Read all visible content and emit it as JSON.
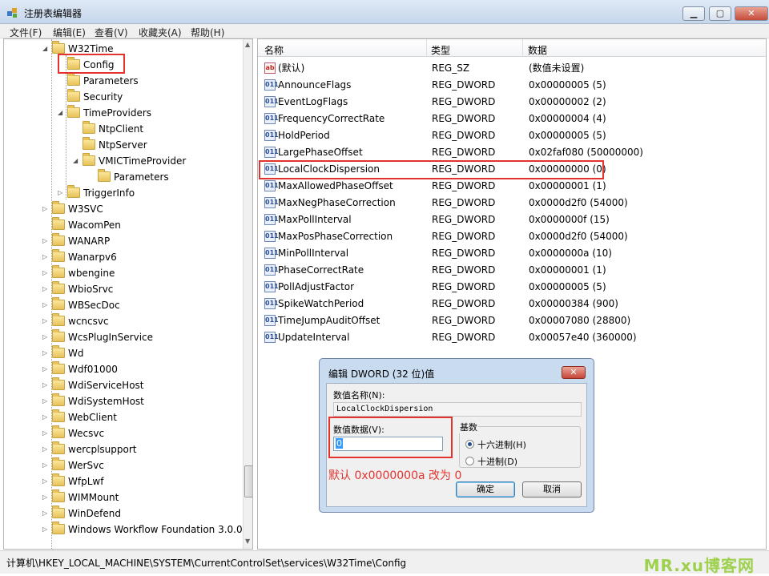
{
  "window": {
    "title": "注册表编辑器",
    "btn_min": "▁",
    "btn_max": "▢",
    "btn_close": "✕"
  },
  "menu": [
    "文件(F)",
    "编辑(E)",
    "查看(V)",
    "收藏夹(A)",
    "帮助(H)"
  ],
  "tree": [
    {
      "label": "W32Time",
      "exp": "◢"
    },
    {
      "label": "Config",
      "exp": ""
    },
    {
      "label": "Parameters",
      "exp": ""
    },
    {
      "label": "Security",
      "exp": ""
    },
    {
      "label": "TimeProviders",
      "exp": "◢"
    },
    {
      "label": "NtpClient",
      "exp": ""
    },
    {
      "label": "NtpServer",
      "exp": ""
    },
    {
      "label": "VMICTimeProvider",
      "exp": "◢"
    },
    {
      "label": "Parameters",
      "exp": ""
    },
    {
      "label": "TriggerInfo",
      "exp": "▷"
    },
    {
      "label": "W3SVC",
      "exp": "▷"
    },
    {
      "label": "WacomPen",
      "exp": ""
    },
    {
      "label": "WANARP",
      "exp": "▷"
    },
    {
      "label": "Wanarpv6",
      "exp": "▷"
    },
    {
      "label": "wbengine",
      "exp": "▷"
    },
    {
      "label": "WbioSrvc",
      "exp": "▷"
    },
    {
      "label": "WBSecDoc",
      "exp": "▷"
    },
    {
      "label": "wcncsvc",
      "exp": "▷"
    },
    {
      "label": "WcsPlugInService",
      "exp": "▷"
    },
    {
      "label": "Wd",
      "exp": "▷"
    },
    {
      "label": "Wdf01000",
      "exp": "▷"
    },
    {
      "label": "WdiServiceHost",
      "exp": "▷"
    },
    {
      "label": "WdiSystemHost",
      "exp": "▷"
    },
    {
      "label": "WebClient",
      "exp": "▷"
    },
    {
      "label": "Wecsvc",
      "exp": "▷"
    },
    {
      "label": "wercplsupport",
      "exp": "▷"
    },
    {
      "label": "WerSvc",
      "exp": "▷"
    },
    {
      "label": "WfpLwf",
      "exp": "▷"
    },
    {
      "label": "WIMMount",
      "exp": "▷"
    },
    {
      "label": "WinDefend",
      "exp": "▷"
    },
    {
      "label": "Windows Workflow Foundation 3.0.0",
      "exp": "▷"
    }
  ],
  "values_header": {
    "name": "名称",
    "type": "类型",
    "data": "数据"
  },
  "values": [
    {
      "icon": "ab",
      "name": "(默认)",
      "type": "REG_SZ",
      "data": "(数值未设置)"
    },
    {
      "icon": "011",
      "name": "AnnounceFlags",
      "type": "REG_DWORD",
      "data": "0x00000005 (5)"
    },
    {
      "icon": "011",
      "name": "EventLogFlags",
      "type": "REG_DWORD",
      "data": "0x00000002 (2)"
    },
    {
      "icon": "011",
      "name": "FrequencyCorrectRate",
      "type": "REG_DWORD",
      "data": "0x00000004 (4)"
    },
    {
      "icon": "011",
      "name": "HoldPeriod",
      "type": "REG_DWORD",
      "data": "0x00000005 (5)"
    },
    {
      "icon": "011",
      "name": "LargePhaseOffset",
      "type": "REG_DWORD",
      "data": "0x02faf080 (50000000)"
    },
    {
      "icon": "011",
      "name": "LocalClockDispersion",
      "type": "REG_DWORD",
      "data": "0x00000000 (0)"
    },
    {
      "icon": "011",
      "name": "MaxAllowedPhaseOffset",
      "type": "REG_DWORD",
      "data": "0x00000001 (1)"
    },
    {
      "icon": "011",
      "name": "MaxNegPhaseCorrection",
      "type": "REG_DWORD",
      "data": "0x0000d2f0 (54000)"
    },
    {
      "icon": "011",
      "name": "MaxPollInterval",
      "type": "REG_DWORD",
      "data": "0x0000000f (15)"
    },
    {
      "icon": "011",
      "name": "MaxPosPhaseCorrection",
      "type": "REG_DWORD",
      "data": "0x0000d2f0 (54000)"
    },
    {
      "icon": "011",
      "name": "MinPollInterval",
      "type": "REG_DWORD",
      "data": "0x0000000a (10)"
    },
    {
      "icon": "011",
      "name": "PhaseCorrectRate",
      "type": "REG_DWORD",
      "data": "0x00000001 (1)"
    },
    {
      "icon": "011",
      "name": "PollAdjustFactor",
      "type": "REG_DWORD",
      "data": "0x00000005 (5)"
    },
    {
      "icon": "011",
      "name": "SpikeWatchPeriod",
      "type": "REG_DWORD",
      "data": "0x00000384 (900)"
    },
    {
      "icon": "011",
      "name": "TimeJumpAuditOffset",
      "type": "REG_DWORD",
      "data": "0x00007080 (28800)"
    },
    {
      "icon": "011",
      "name": "UpdateInterval",
      "type": "REG_DWORD",
      "data": "0x00057e40 (360000)"
    }
  ],
  "dialog": {
    "title": "编辑 DWORD (32 位)值",
    "close": "✕",
    "name_label": "数值名称(N):",
    "name_value": "LocalClockDispersion",
    "data_label": "数值数据(V):",
    "data_value": "0",
    "base_label": "基数",
    "hex_label": "十六进制(H)",
    "dec_label": "十进制(D)",
    "annotation": "默认 0x0000000a 改为 0",
    "ok": "确定",
    "cancel": "取消"
  },
  "status": {
    "path": "计算机\\HKEY_LOCAL_MACHINE\\SYSTEM\\CurrentControlSet\\services\\W32Time\\Config",
    "watermark": "MR.xu博客网"
  },
  "colors": {
    "highlight_box": "#e2332f",
    "watermark": "#9ed14f"
  }
}
